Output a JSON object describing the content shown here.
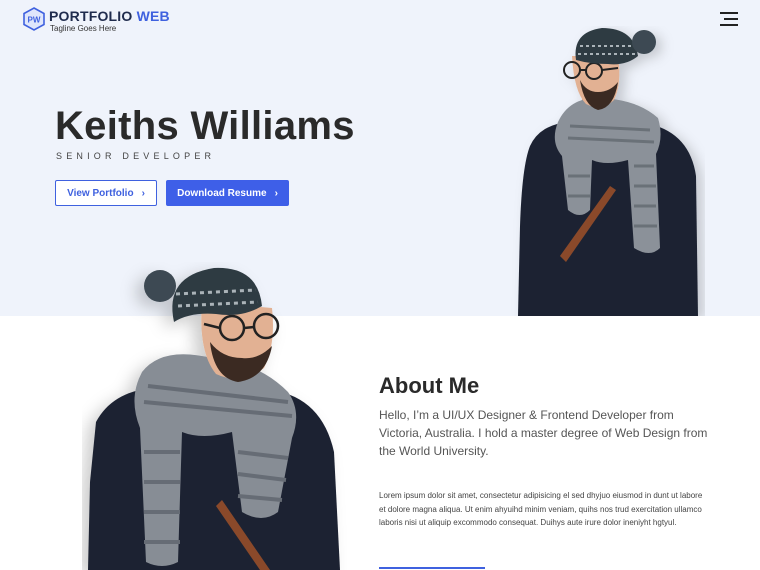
{
  "brand": {
    "title_main": "PORTFOLIO",
    "title_accent": "WEB",
    "tagline": "Tagline Goes Here",
    "logo_icon": "hexagon-pw-logo",
    "accent_color": "#3f61df"
  },
  "header": {
    "menu_icon": "hamburger-menu-icon"
  },
  "hero": {
    "name": "Keiths Williams",
    "role": "SENIOR DEVELOPER",
    "buttons": [
      {
        "label": "View Portfolio",
        "icon": "chevron-right-icon"
      },
      {
        "label": "Download Resume",
        "icon": "chevron-right-icon"
      }
    ],
    "background_color": "#eff3fb"
  },
  "about": {
    "title": "About Me",
    "intro": "Hello, I’m a UI/UX Designer & Frontend Developer from Victoria, Australia. I hold a master degree of Web Design from the World University.",
    "body": "Lorem ipsum dolor sit amet, consectetur adipisicing el sed dhyjuo eiusmod in dunt ut labore et dolore magna aliqua. Ut enim ahyuihd minim veniam, quihs nos trud exercitation ullamco laboris nisi ut aliquip excommodo consequat. Duihys aute irure dolor ineniyht hgtyul."
  }
}
